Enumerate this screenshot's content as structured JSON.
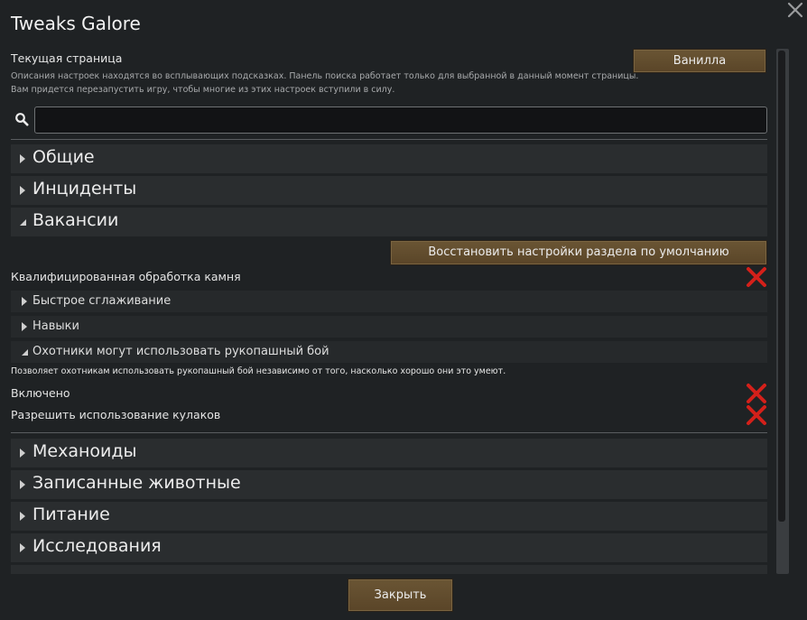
{
  "window": {
    "title": "Tweaks Galore"
  },
  "header": {
    "current_page": "Текущая страница",
    "desc_line1": "Описания настроек находятся во всплывающих подсказках. Панель поиска работает только для выбранной в данный момент страницы.",
    "desc_line2": "Вам придется перезапустить игру, чтобы многие из этих настроек вступили в силу.",
    "vanilla_label": "Ванилла"
  },
  "search": {
    "value": "",
    "placeholder": ""
  },
  "sections": [
    {
      "label": "Общие",
      "expanded": false
    },
    {
      "label": "Инциденты",
      "expanded": false
    },
    {
      "label": "Вакансии",
      "expanded": true
    },
    {
      "label": "Механоиды",
      "expanded": false
    },
    {
      "label": "Записанные животные",
      "expanded": false
    },
    {
      "label": "Питание",
      "expanded": false
    },
    {
      "label": "Исследования",
      "expanded": false
    }
  ],
  "jobs": {
    "reset_label": "Восстановить настройки раздела по умолчанию",
    "skilled_stonecutting": "Квалифицированная обработка камня",
    "subsections": [
      {
        "label": "Быстрое сглаживание",
        "expanded": false
      },
      {
        "label": "Навыки",
        "expanded": false
      },
      {
        "label": "Охотники могут использовать рукопашный бой",
        "expanded": true
      }
    ],
    "hunters_desc": "Позволяет охотникам использовать рукопашный бой независимо от того, насколько хорошо они это умеют.",
    "enabled_label": "Включено",
    "allow_fists_label": "Разрешить использование кулаков"
  },
  "footer": {
    "close_label": "Закрыть"
  },
  "colors": {
    "background": "#1f2224",
    "row": "#2a2d2f",
    "button": "#5f4a2c",
    "x_red": "#d4201a"
  },
  "icons": {
    "close": "close-icon",
    "search": "search-icon",
    "collapsed": "triangle-right-icon",
    "expanded": "triangle-down-icon",
    "toggle_off": "red-x-icon"
  }
}
